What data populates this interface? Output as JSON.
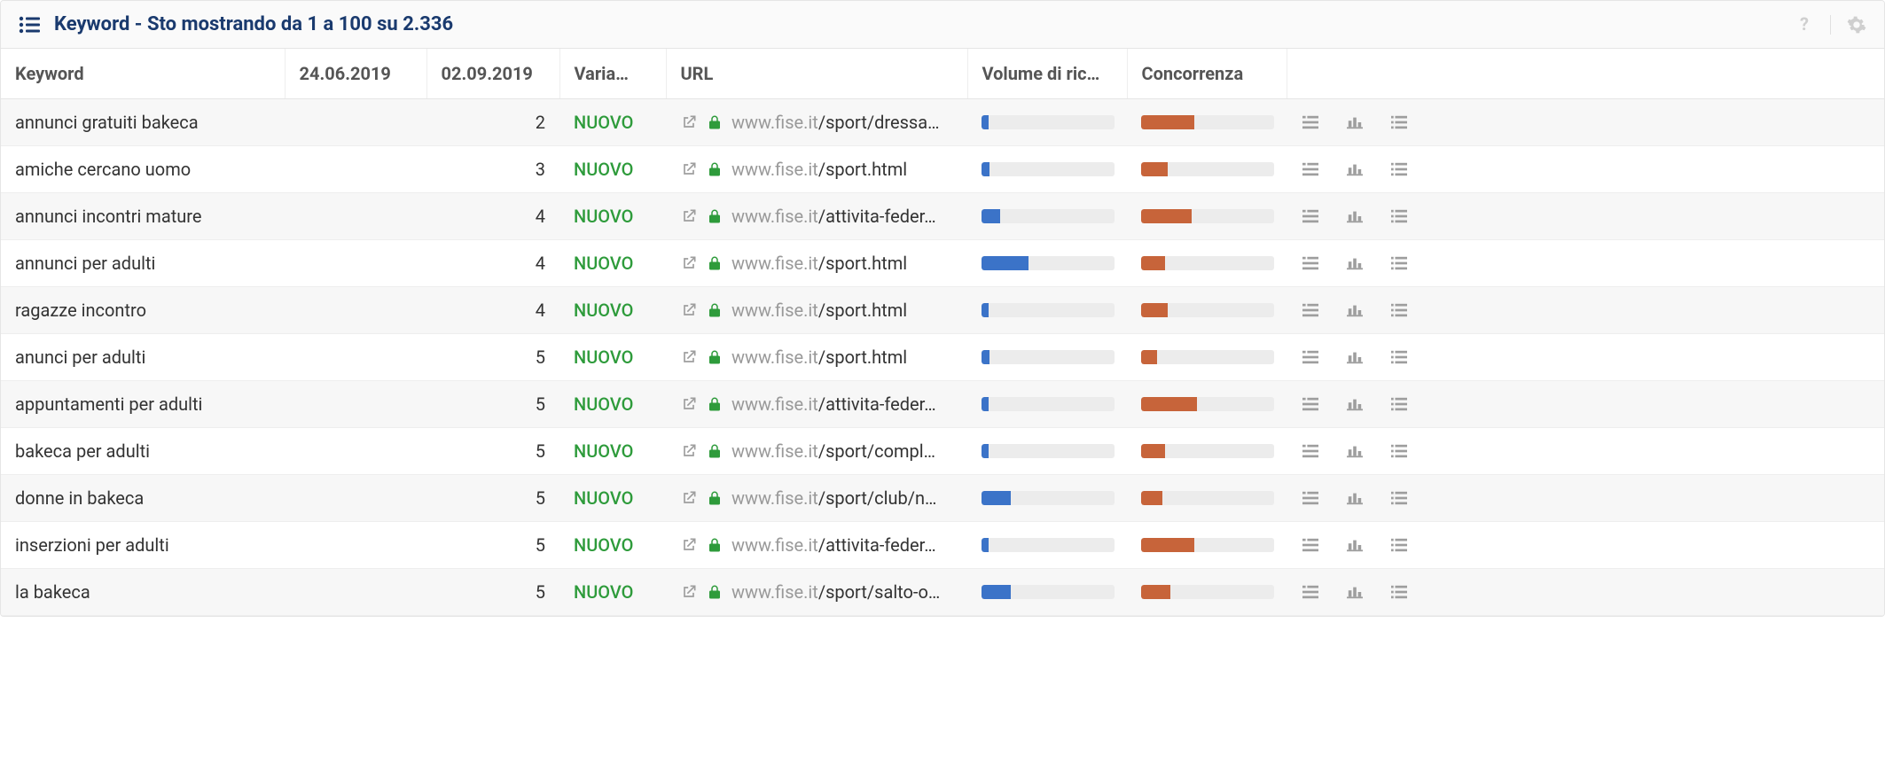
{
  "header": {
    "title": "Keyword - Sto mostrando da 1 a 100 su 2.336"
  },
  "columns": {
    "keyword": "Keyword",
    "date1": "24.06.2019",
    "date2": "02.09.2019",
    "varia": "Varia…",
    "url": "URL",
    "vol": "Volume di ric…",
    "conc": "Concorrenza"
  },
  "rows": [
    {
      "keyword": "annunci gratuiti bakeca",
      "date1": "",
      "date2": "2",
      "varia": "NUOVO",
      "domain": "www.fise.it",
      "path": "/sport/dressa…",
      "vol": 5,
      "conc": 40
    },
    {
      "keyword": "amiche cercano uomo",
      "date1": "",
      "date2": "3",
      "varia": "NUOVO",
      "domain": "www.fise.it",
      "path": "/sport.html",
      "vol": 6,
      "conc": 20
    },
    {
      "keyword": "annunci incontri mature",
      "date1": "",
      "date2": "4",
      "varia": "NUOVO",
      "domain": "www.fise.it",
      "path": "/attivita-feder…",
      "vol": 14,
      "conc": 38
    },
    {
      "keyword": "annunci per adulti",
      "date1": "",
      "date2": "4",
      "varia": "NUOVO",
      "domain": "www.fise.it",
      "path": "/sport.html",
      "vol": 35,
      "conc": 18
    },
    {
      "keyword": "ragazze incontro",
      "date1": "",
      "date2": "4",
      "varia": "NUOVO",
      "domain": "www.fise.it",
      "path": "/sport.html",
      "vol": 5,
      "conc": 20
    },
    {
      "keyword": "anunci per adulti",
      "date1": "",
      "date2": "5",
      "varia": "NUOVO",
      "domain": "www.fise.it",
      "path": "/sport.html",
      "vol": 6,
      "conc": 12
    },
    {
      "keyword": "appuntamenti per adulti",
      "date1": "",
      "date2": "5",
      "varia": "NUOVO",
      "domain": "www.fise.it",
      "path": "/attivita-feder…",
      "vol": 5,
      "conc": 42
    },
    {
      "keyword": "bakeca per adulti",
      "date1": "",
      "date2": "5",
      "varia": "NUOVO",
      "domain": "www.fise.it",
      "path": "/sport/compl…",
      "vol": 5,
      "conc": 18
    },
    {
      "keyword": "donne in bakeca",
      "date1": "",
      "date2": "5",
      "varia": "NUOVO",
      "domain": "www.fise.it",
      "path": "/sport/club/n…",
      "vol": 22,
      "conc": 16
    },
    {
      "keyword": "inserzioni per adulti",
      "date1": "",
      "date2": "5",
      "varia": "NUOVO",
      "domain": "www.fise.it",
      "path": "/attivita-feder…",
      "vol": 5,
      "conc": 40
    },
    {
      "keyword": "la bakeca",
      "date1": "",
      "date2": "5",
      "varia": "NUOVO",
      "domain": "www.fise.it",
      "path": "/sport/salto-o…",
      "vol": 22,
      "conc": 22
    }
  ]
}
